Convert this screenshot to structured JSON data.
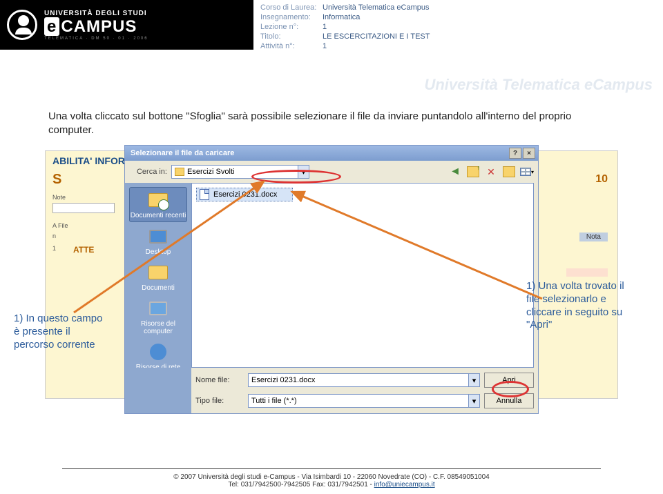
{
  "header": {
    "uni_top": "UNIVERSITÀ DEGLI STUDI",
    "campus_e": "e",
    "campus_rest": "CAMPUS",
    "sub": "TELEMATICA · DM 50 · 01 · 2006",
    "meta": {
      "corso_label": "Corso di Laurea:",
      "corso_val": "Università Telematica eCampus",
      "ins_label": "Insegnamento:",
      "ins_val": "Informatica",
      "lez_label": "Lezione n°:",
      "lez_val": "1",
      "tit_label": "Titolo:",
      "tit_val": "LE ESCERCITAZIONI E I TEST",
      "att_label": "Attività n°:",
      "att_val": "1"
    }
  },
  "watermark_text": "Università Telematica eCampus",
  "paragraph": "Una volta cliccato sul bottone \"Sfoglia\" sarà possibile selezionare il file da inviare puntandolo all'interno del proprio computer.",
  "bgform": {
    "hdr": "ABILITA' INFORM",
    "s": "S",
    "note": "Note",
    "afile": "A  File",
    "n": "n",
    "one": "1",
    "att": "ATTE",
    "n10": "10",
    "nota": "Nota"
  },
  "dialog": {
    "title": "Selezionare il file da caricare",
    "help": "?",
    "close": "×",
    "lookin_label": "Cerca in:",
    "lookin_val": "Esercizi Svolti",
    "places": {
      "recent": "Documenti recenti",
      "desktop": "Desktop",
      "docs": "Documenti",
      "mycomp": "Risorse del computer",
      "net": "Risorse di rete"
    },
    "file_item": "Esercizi 0231.docx",
    "fname_label": "Nome file:",
    "fname_val": "Esercizi 0231.docx",
    "ftype_label": "Tipo file:",
    "ftype_val": "Tutti i file (*.*)",
    "open_btn": "Apri",
    "cancel_btn": "Annulla",
    "dd_glyph": "▾"
  },
  "annotations": {
    "left": "1) In questo campo è presente il percorso corrente",
    "right": "1) Una volta trovato il file selezionarlo e cliccare in seguito su \"Apri\""
  },
  "footer": {
    "line1": "© 2007 Università degli studi e-Campus - Via Isimbardi 10 - 22060 Novedrate (CO) - C.F. 08549051004",
    "line2_a": "Tel: 031/7942500-7942505 Fax: 031/7942501 - ",
    "email": "info@uniecampus.it"
  }
}
